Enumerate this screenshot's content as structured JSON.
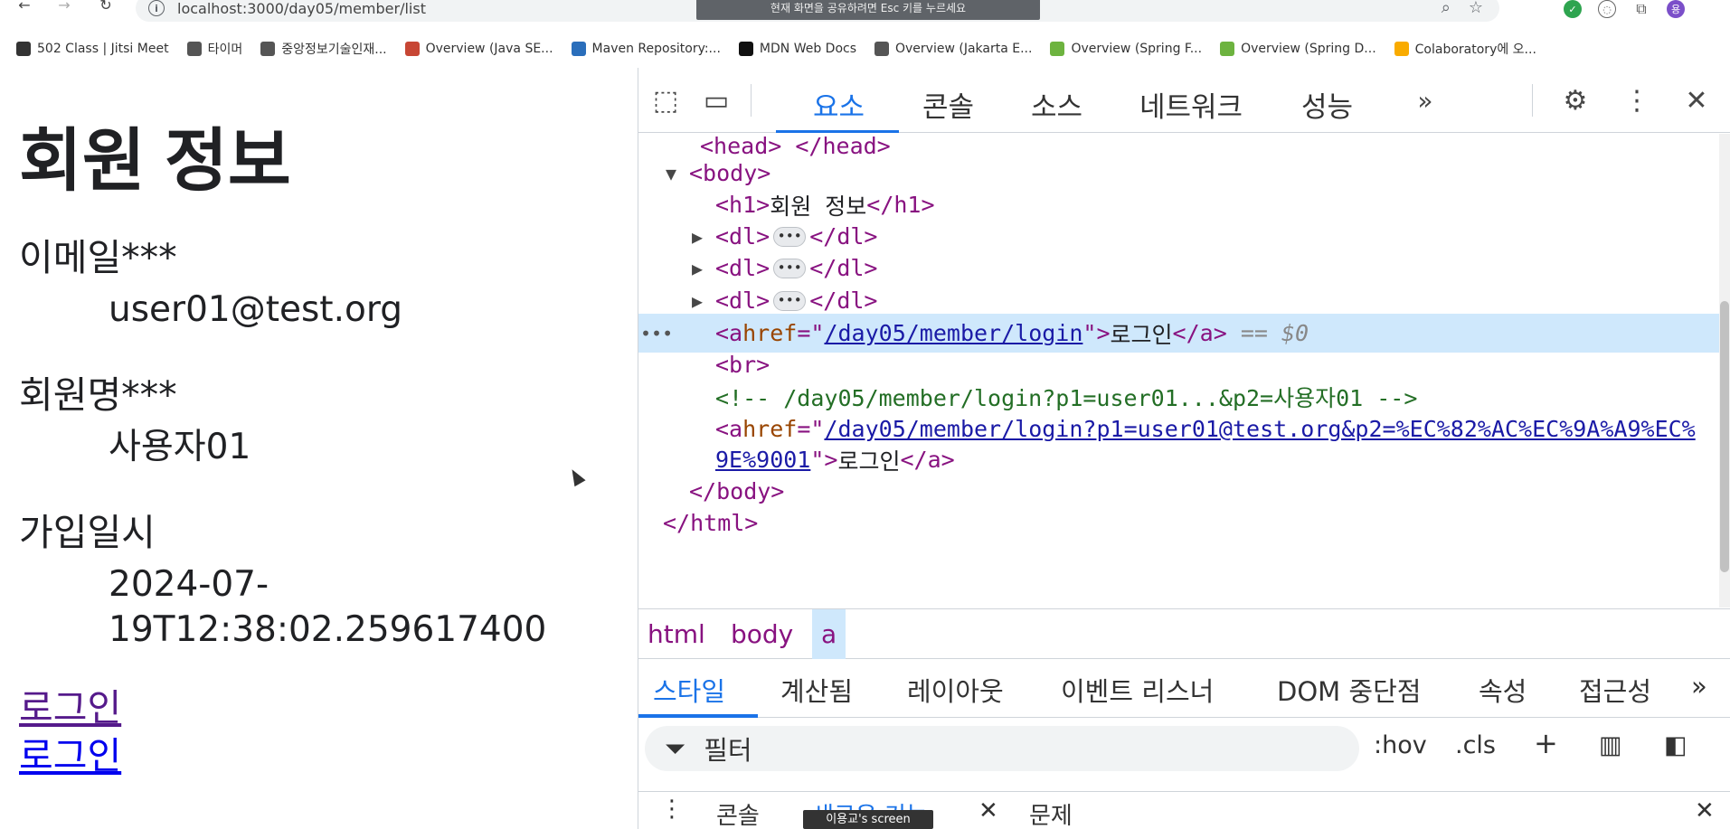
{
  "browser": {
    "url": "localhost:3000/day05/member/list",
    "share_banner": "현재 화면을 공유하려면 Esc 키를 누르세요",
    "bookmarks": [
      {
        "label": "502 Class | Jitsi Meet",
        "icon": "jitsi-icon",
        "color": "#333333"
      },
      {
        "label": "타이머",
        "icon": "globe-icon",
        "color": "#555555"
      },
      {
        "label": "중앙정보기술인재...",
        "icon": "globe-icon",
        "color": "#555555"
      },
      {
        "label": "Overview (Java SE...",
        "icon": "oracle-icon",
        "color": "#c74634"
      },
      {
        "label": "Maven Repository:...",
        "icon": "maven-icon",
        "color": "#2a6ebb"
      },
      {
        "label": "MDN Web Docs",
        "icon": "mdn-icon",
        "color": "#111111"
      },
      {
        "label": "Overview (Jakarta E...",
        "icon": "globe-icon",
        "color": "#555555"
      },
      {
        "label": "Overview (Spring F...",
        "icon": "spring-icon",
        "color": "#6db33f"
      },
      {
        "label": "Overview (Spring D...",
        "icon": "spring-icon",
        "color": "#6db33f"
      },
      {
        "label": "Colaboratory에 오...",
        "icon": "colab-icon",
        "color": "#f9ab00"
      }
    ]
  },
  "page": {
    "title": "회원 정보",
    "fields": [
      {
        "label": "이메일***",
        "value": "user01@test.org"
      },
      {
        "label": "회원명***",
        "value": "사용자01"
      },
      {
        "label": "가입일시",
        "value_line1": "2024-07-",
        "value_line2": "19T12:38:02.259617400"
      }
    ],
    "links": [
      "로그인",
      "로그인"
    ]
  },
  "devtools": {
    "tabs": [
      "요소",
      "콘솔",
      "소스",
      "네트워크",
      "성능"
    ],
    "active_tab": "요소",
    "dom": {
      "head_partial": "<head> </head>",
      "body_open": "<body>",
      "h1_open": "<h1>",
      "h1_text": "회원 정보",
      "h1_close": "</h1>",
      "dl_open": "<dl>",
      "dl_close": "</dl>",
      "a_open_start": "<a ",
      "href_attr": "href",
      "href1": "/day05/member/login",
      "a_text": "로그인",
      "a_close": "</a>",
      "dollar_ref": "== $0",
      "br": "<br>",
      "comment": "<!-- /day05/member/login?p1=user01...&p2=사용자01 -->",
      "href2_line1": "/day05/member/login?p1=user01@test.org&p2=%EC%82%AC%EC%9A%A9%EC%",
      "href2_line2": "9E%9001",
      "body_close": "</body>",
      "html_close": "</html>"
    },
    "breadcrumbs": [
      "html",
      "body",
      "a"
    ],
    "style_tabs": [
      "스타일",
      "계산됨",
      "레이아웃",
      "이벤트 리스너",
      "DOM 중단점",
      "속성",
      "접근성"
    ],
    "filter_placeholder": "필터",
    "hov": ":hov",
    "cls": ".cls",
    "drawer_tabs": [
      "콘솔",
      "새로운 기능",
      "문제"
    ],
    "screen_tooltip": "이용교's screen"
  }
}
